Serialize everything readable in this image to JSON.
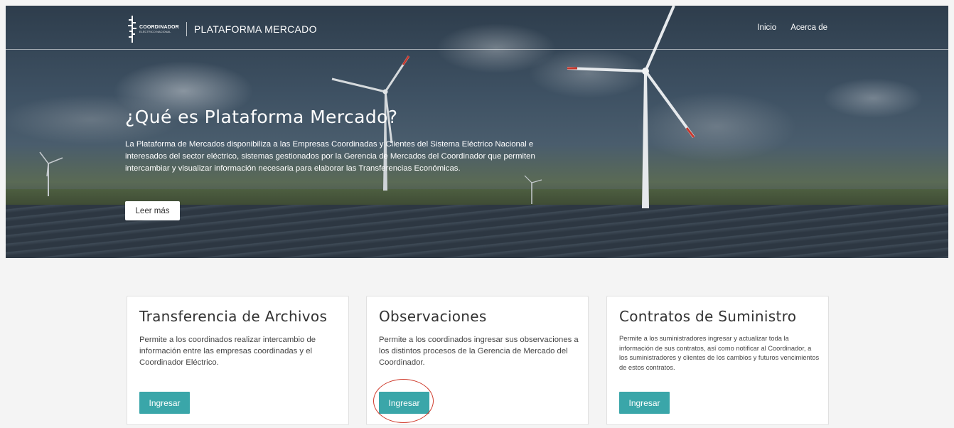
{
  "header": {
    "logo": {
      "line1": "COORDINADOR",
      "line2": "ELÉCTRICO NACIONAL"
    },
    "brand": "PLATAFORMA MERCADO",
    "nav": [
      "Inicio",
      "Acerca de"
    ]
  },
  "hero": {
    "title": "¿Qué es Plataforma Mercado?",
    "description": "La Plataforma de Mercados disponibiliza a las Empresas Coordinadas y Clientes del Sistema Eléctrico Nacional e interesados del sector eléctrico, sistemas gestionados por la Gerencia de Mercados del Coordinador que permiten intercambiar y visualizar información necesaria para elaborar las Transferencias Económicas.",
    "button": "Leer más"
  },
  "cards": [
    {
      "title": "Transferencia de Archivos",
      "description": "Permite a los coordinados realizar intercambio de información entre las empresas coordinadas y el Coordinador Eléctrico.",
      "button": "Ingresar"
    },
    {
      "title": "Observaciones",
      "description": "Permite a los coordinados ingresar sus observaciones a los distintos procesos de la Gerencia de Mercado del Coordinador.",
      "button": "Ingresar"
    },
    {
      "title": "Contratos de Suministro",
      "description": "Permite a los suministradores ingresar y actualizar toda la información de sus contratos, así como notificar al Coordinador, a los suministradores y clientes de los cambios y futuros vencimientos de estos contratos.",
      "button": "Ingresar"
    }
  ],
  "colors": {
    "accent": "#3aa6a9",
    "highlight_circle": "#cf3b2c"
  }
}
